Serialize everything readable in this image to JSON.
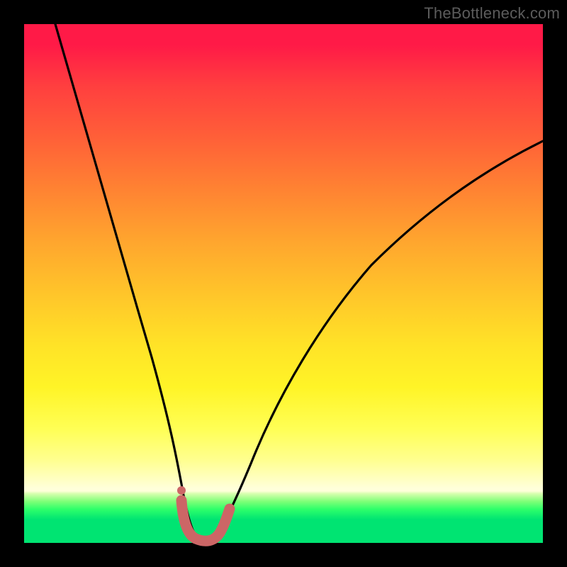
{
  "watermark": "TheBottleneck.com",
  "colors": {
    "frame": "#000000",
    "curve": "#000000",
    "marker": "#cc6666",
    "gradient_top": "#ff1a47",
    "gradient_mid": "#ffe327",
    "gradient_green": "#00e472"
  },
  "chart_data": {
    "type": "line",
    "title": "",
    "xlabel": "",
    "ylabel": "",
    "xlim": [
      0,
      100
    ],
    "ylim": [
      0,
      100
    ],
    "series": [
      {
        "name": "bottleneck-curve",
        "x": [
          6,
          10,
          14,
          18,
          22,
          25,
          27,
          29,
          30,
          31,
          32,
          33,
          34,
          35,
          37,
          40,
          45,
          50,
          55,
          60,
          65,
          70,
          75,
          80,
          85,
          90,
          95,
          100
        ],
        "values": [
          100,
          87,
          74,
          61,
          47,
          33,
          22,
          13,
          8,
          3,
          1,
          0.5,
          0.5,
          1,
          3,
          8,
          19,
          29,
          38,
          46,
          53,
          59,
          64,
          68,
          71,
          74,
          76,
          78
        ]
      }
    ],
    "annotations": [
      {
        "name": "valley-marker",
        "x_range": [
          29,
          36
        ],
        "y_range": [
          0,
          8
        ]
      }
    ]
  }
}
